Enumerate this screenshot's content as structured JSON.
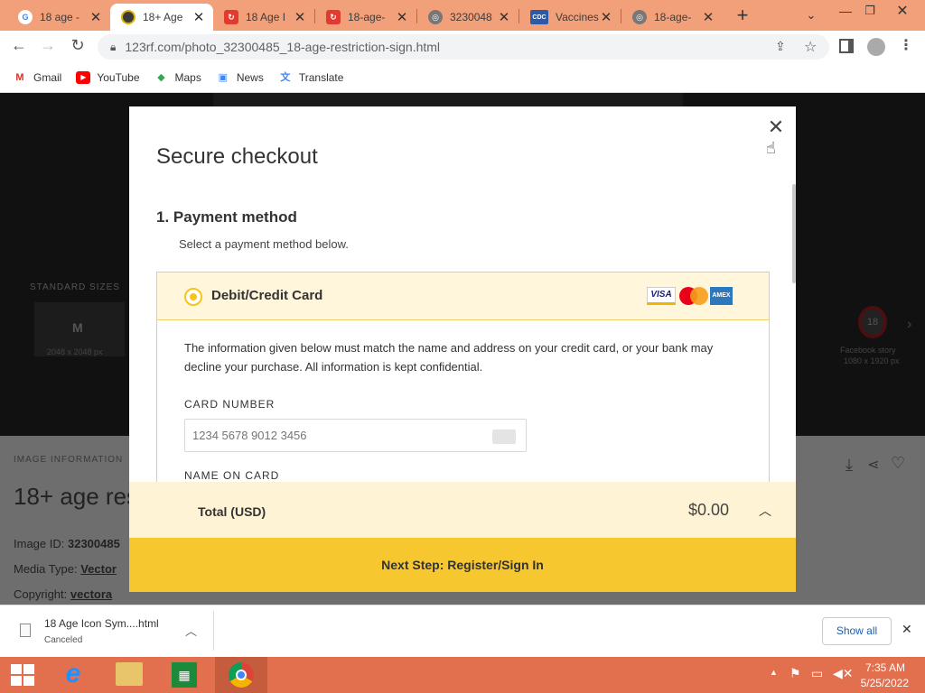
{
  "browser": {
    "tabs": [
      {
        "title": "18 age -",
        "favicon": "google-icon"
      },
      {
        "title": "18+ Age",
        "favicon": "123rf-icon",
        "active": true
      },
      {
        "title": "18 Age I",
        "favicon": "red-square-icon"
      },
      {
        "title": "18-age-",
        "favicon": "red-square-icon"
      },
      {
        "title": "3230048",
        "favicon": "globe-icon"
      },
      {
        "title": "Vaccines",
        "favicon": "cdc-icon"
      },
      {
        "title": "18-age-",
        "favicon": "globe-icon"
      }
    ],
    "url": "123rf.com/photo_32300485_18-age-restriction-sign.html",
    "bookmarks": [
      {
        "label": "Gmail"
      },
      {
        "label": "YouTube"
      },
      {
        "label": "Maps"
      },
      {
        "label": "News"
      },
      {
        "label": "Translate"
      }
    ]
  },
  "background_page": {
    "standard_sizes": "STANDARD SIZES",
    "size_m": "M",
    "size_m_dims": "2048 x 2048 px",
    "facebook": "Facebook story",
    "facebook_dims": "1080 x 1920 px",
    "image_information": "IMAGE INFORMATION",
    "title": "18+ age res",
    "image_id_label": "Image ID:",
    "image_id": "32300485",
    "media_type_label": "Media Type:",
    "media_type": "Vector",
    "copyright_label": "Copyright:",
    "copyright": "vectora"
  },
  "checkout": {
    "title": "Secure checkout",
    "step": "1.  Payment method",
    "step_desc": "Select a payment method below.",
    "method_label": "Debit/Credit Card",
    "card_logos": [
      "VISA",
      "Mastercard",
      "AMEX"
    ],
    "info": "The information given below must match the name and address on your credit card, or your bank may decline your purchase. All information is kept confidential.",
    "card_number_label": "CARD NUMBER",
    "card_number_placeholder": "1234 5678 9012 3456",
    "name_on_card_label": "NAME ON CARD",
    "total_label": "Total (USD)",
    "total_value": "$0.00",
    "next_button": "Next Step: Register/Sign In"
  },
  "download": {
    "filename": "18 Age Icon Sym....html",
    "status": "Canceled",
    "show_all": "Show all"
  },
  "taskbar": {
    "time": "7:35 AM",
    "date": "5/25/2022"
  },
  "colors": {
    "tabstrip": "#f2a07a",
    "accent_yellow": "#f7c72f",
    "taskbar": "#e2704e"
  }
}
